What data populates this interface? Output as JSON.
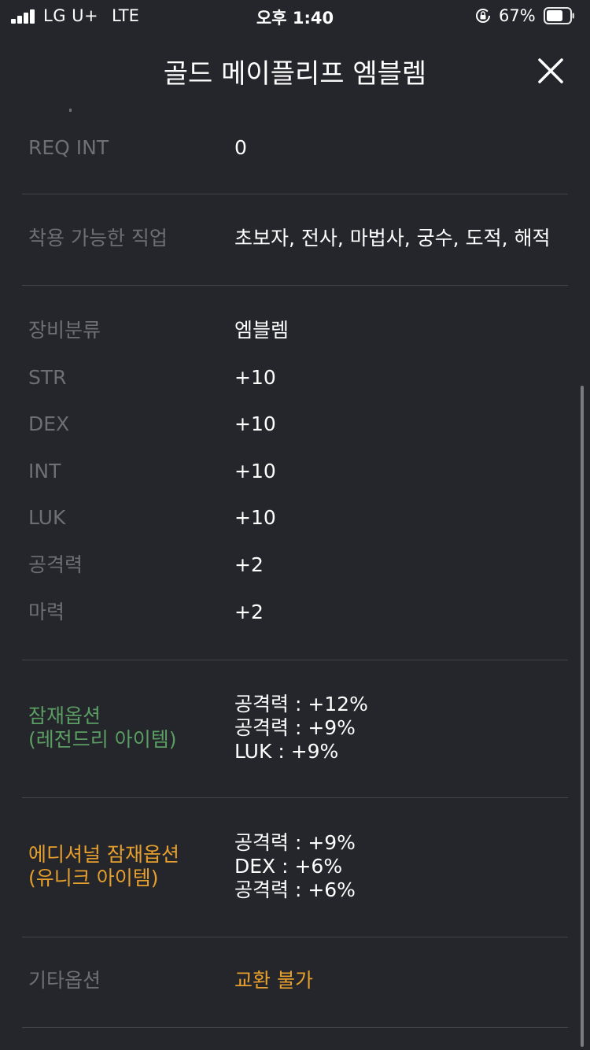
{
  "status_bar": {
    "carrier": "LG U+",
    "network": "LTE",
    "time": "오후 1:40",
    "battery_percent": "67%"
  },
  "header": {
    "title": "골드 메이플리프 엠블렘"
  },
  "requirements": {
    "req_int_label": "REQ INT",
    "req_int_value": "0"
  },
  "jobs": {
    "label": "착용 가능한 직업",
    "value": "초보자, 전사, 마법사, 궁수, 도적, 해적"
  },
  "stats": [
    {
      "label": "장비분류",
      "value": "엠블렘"
    },
    {
      "label": "STR",
      "value": "+10"
    },
    {
      "label": "DEX",
      "value": "+10"
    },
    {
      "label": "INT",
      "value": "+10"
    },
    {
      "label": "LUK",
      "value": "+10"
    },
    {
      "label": "공격력",
      "value": "+2"
    },
    {
      "label": "마력",
      "value": "+2"
    }
  ],
  "potential": {
    "label_line1": "잠재옵션",
    "label_line2": "(레전드리 아이템)",
    "lines": [
      "공격력 : +12%",
      "공격력 : +9%",
      "LUK : +9%"
    ]
  },
  "additional_potential": {
    "label_line1": "에디셔널 잠재옵션",
    "label_line2": "(유니크 아이템)",
    "lines": [
      "공격력 : +9%",
      "DEX : +6%",
      "공격력 : +6%"
    ]
  },
  "other": {
    "label": "기타옵션",
    "value": "교환 불가"
  },
  "colors": {
    "background": "#25262b",
    "label_gray": "#6e6f75",
    "potential_green": "#5a9e63",
    "unique_orange": "#e69f2c",
    "divider": "#44454b"
  }
}
